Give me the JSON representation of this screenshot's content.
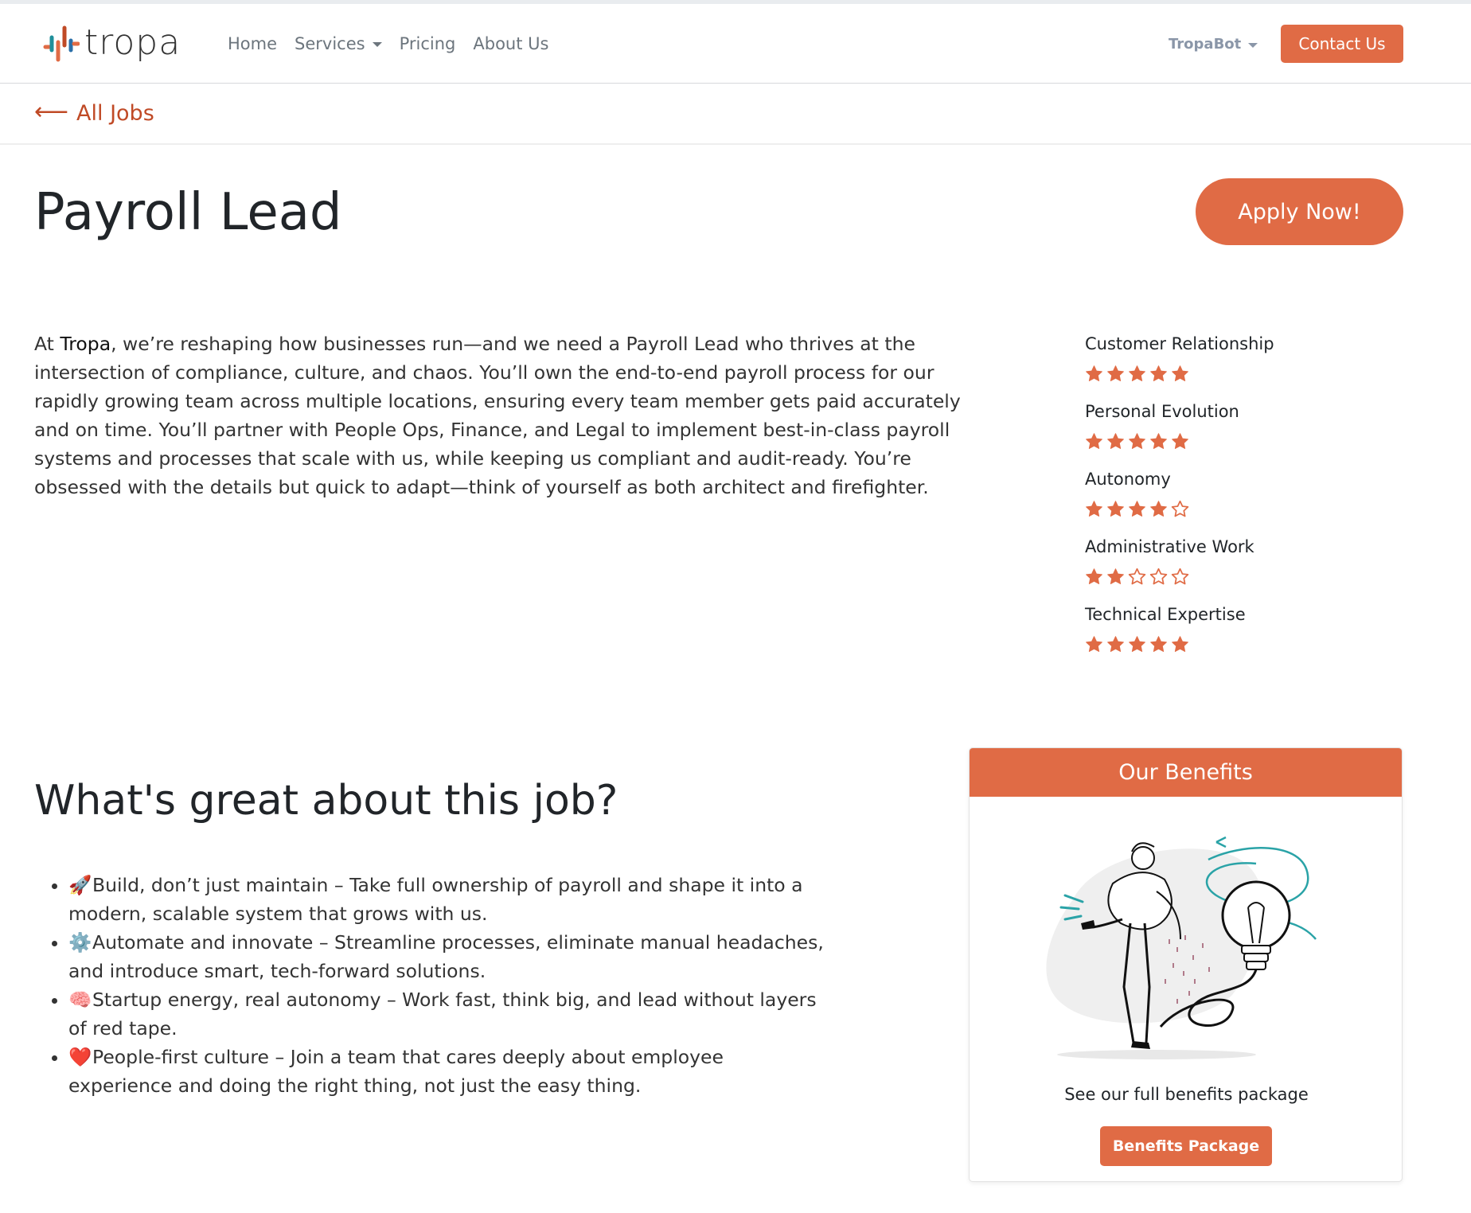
{
  "brand": {
    "name": "tropa",
    "accent_color": "#e06b45",
    "link_color": "#c04a26"
  },
  "nav": {
    "items": [
      {
        "label": "Home"
      },
      {
        "label": "Services",
        "has_dropdown": true
      },
      {
        "label": "Pricing"
      },
      {
        "label": "About Us"
      }
    ],
    "tropabot_label": "TropaBot",
    "contact_label": "Contact Us"
  },
  "back_link": {
    "icon": "arrow-left-icon",
    "label": "All Jobs"
  },
  "job": {
    "title": "Payroll Lead",
    "apply_label": "Apply Now!",
    "description_prefix": " At ",
    "description_company": "Tropa",
    "description_body": ", we’re reshaping how businesses run—and we need a Payroll Lead who thrives at the intersection of compliance, culture, and chaos. You’ll own the end-to-end payroll process for our rapidly growing team across multiple locations, ensuring every team member gets paid accurately and on time. You’ll partner with People Ops, Finance, and Legal to implement best-in-class payroll systems and processes that scale with us, while keeping us compliant and audit-ready. You’re obsessed with the details but quick to adapt—think of yourself as both architect and firefighter."
  },
  "ratings": [
    {
      "label": "Customer Relationship",
      "stars": 5,
      "max": 5
    },
    {
      "label": "Personal Evolution",
      "stars": 5,
      "max": 5
    },
    {
      "label": "Autonomy",
      "stars": 4,
      "max": 5
    },
    {
      "label": "Administrative Work",
      "stars": 2,
      "max": 5
    },
    {
      "label": "Technical Expertise",
      "stars": 5,
      "max": 5
    }
  ],
  "great": {
    "title": "What's great about this job?",
    "items": [
      {
        "emoji": "🚀",
        "text": "Build, don’t just maintain – Take full ownership of payroll and shape it into a modern, scalable system that grows with us."
      },
      {
        "emoji": "⚙️",
        "text": "Automate and innovate – Streamline processes, eliminate manual headaches, and introduce smart, tech-forward solutions."
      },
      {
        "emoji": "🧠",
        "text": "Startup energy, real autonomy – Work fast, think big, and lead without layers of red tape."
      },
      {
        "emoji": "❤️",
        "text": "People-first culture – Join a team that cares deeply about employee experience and doing the right thing, not just the easy thing."
      }
    ]
  },
  "benefits": {
    "header": "Our Benefits",
    "text": "See our full benefits package",
    "button_label": "Benefits Package"
  }
}
